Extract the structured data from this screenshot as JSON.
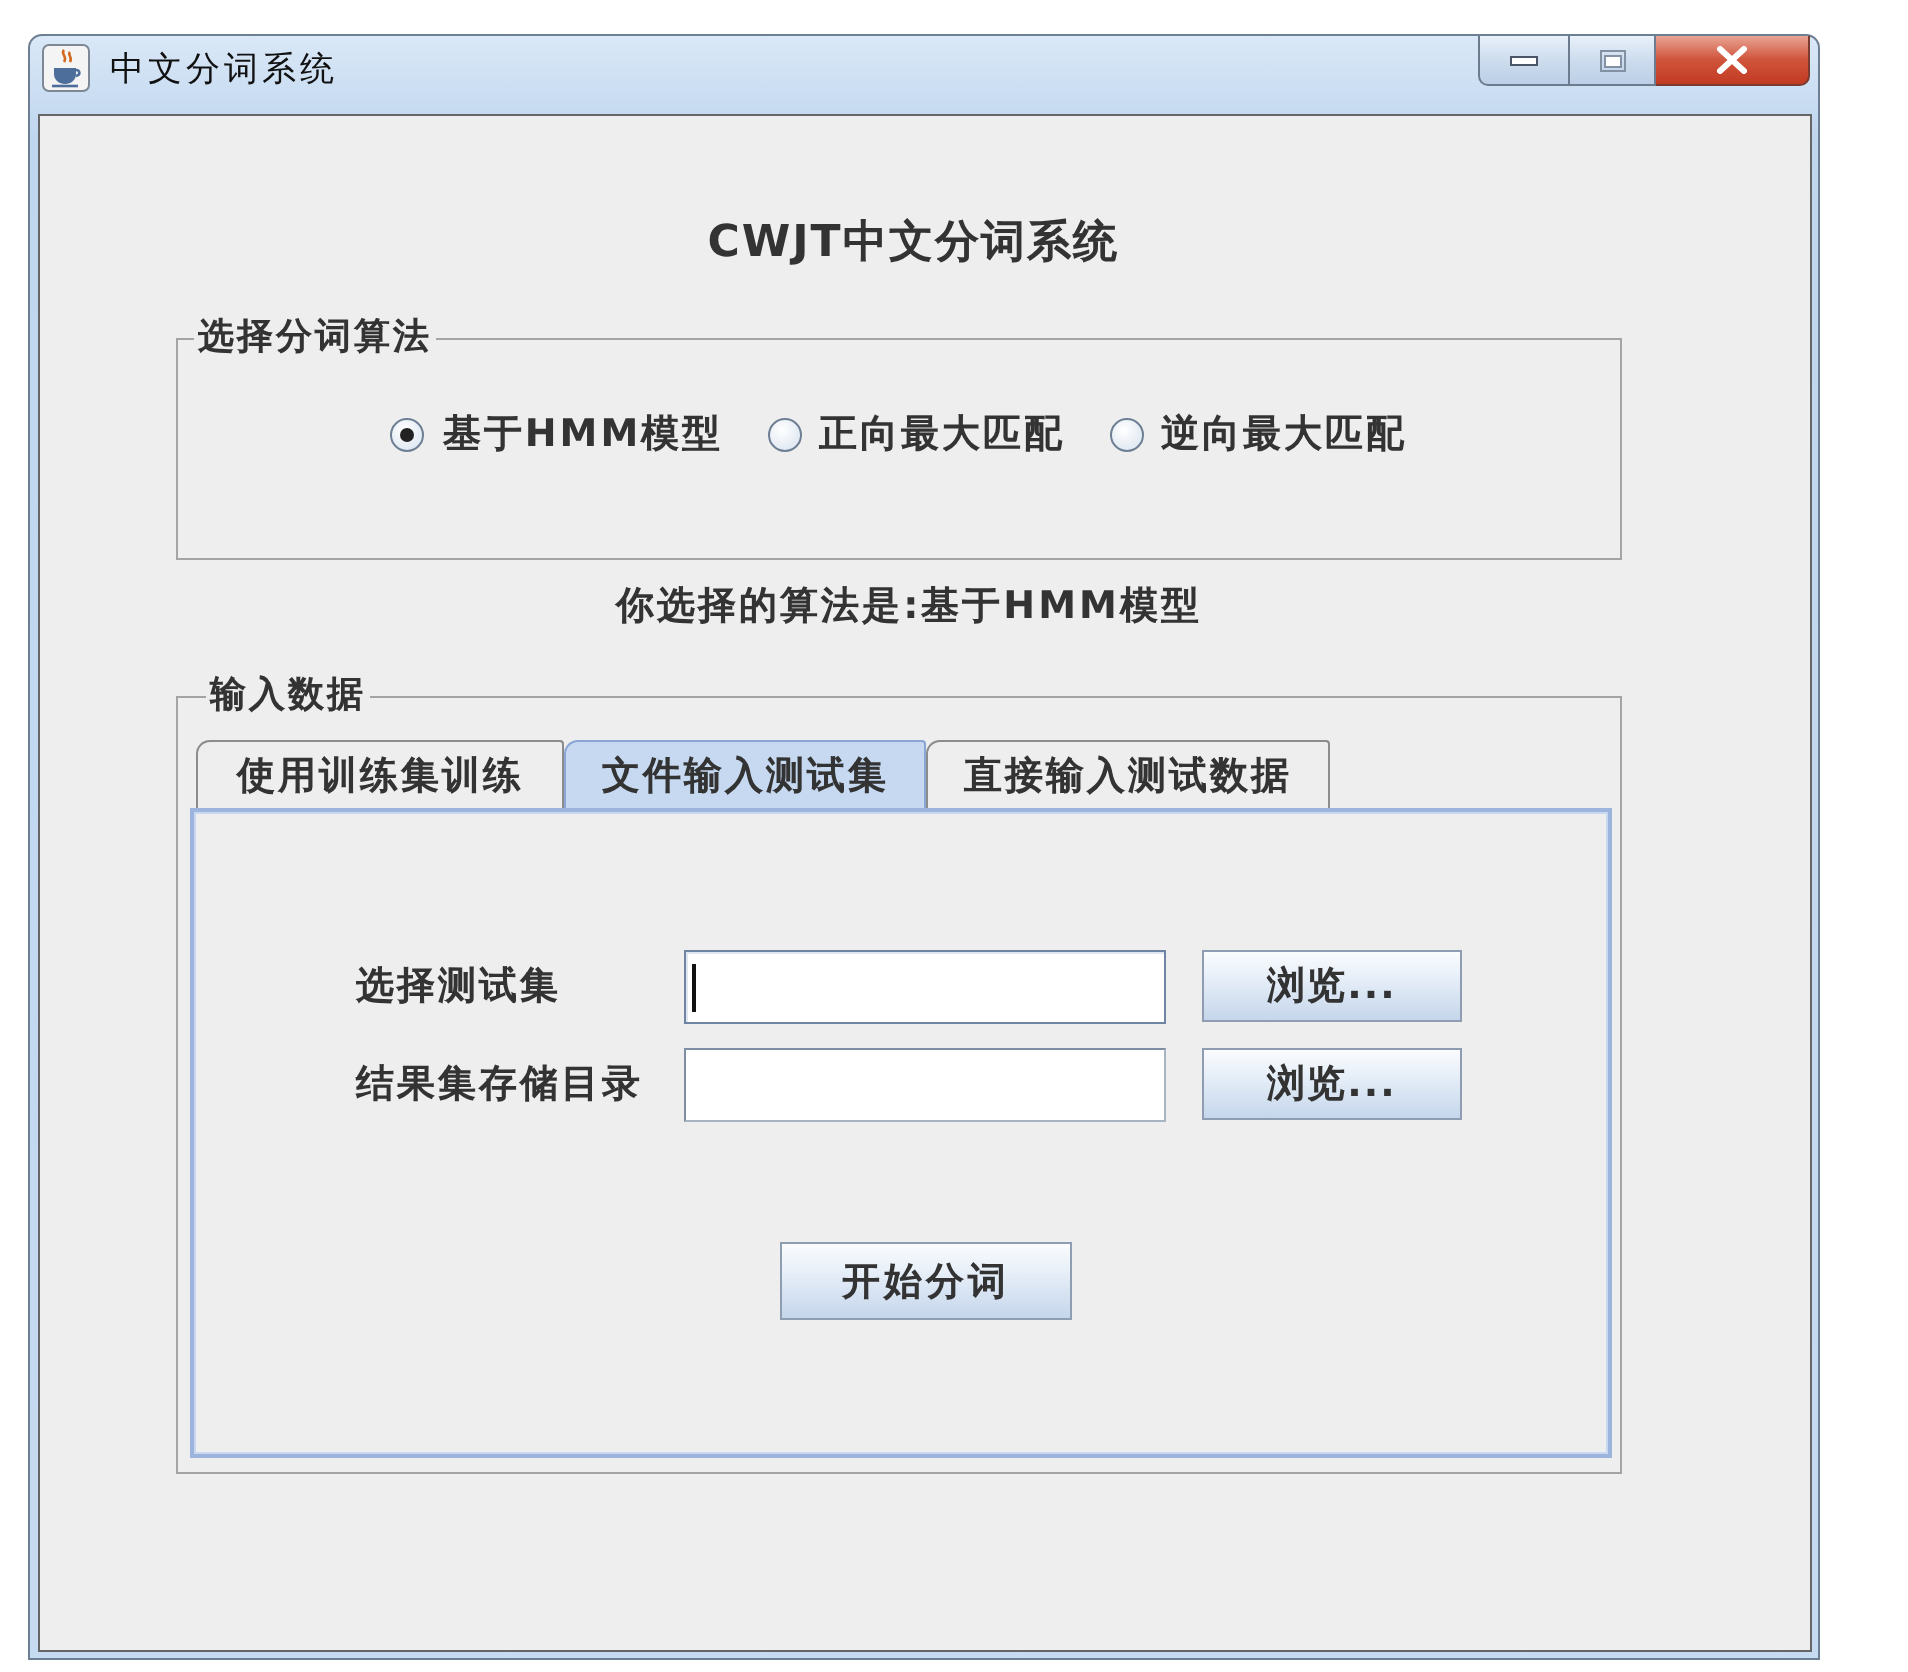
{
  "window": {
    "title": "中文分词系统"
  },
  "heading": "CWJT中文分词系统",
  "algorithm_group": {
    "legend": "选择分词算法",
    "options": [
      {
        "label": "基于HMM模型",
        "selected": true
      },
      {
        "label": "正向最大匹配",
        "selected": false
      },
      {
        "label": "逆向最大匹配",
        "selected": false
      }
    ]
  },
  "selection_status": "你选择的算法是:基于HMM模型",
  "input_group": {
    "legend": "输入数据",
    "tabs": [
      {
        "label": "使用训练集训练",
        "selected": false
      },
      {
        "label": "文件输入测试集",
        "selected": true
      },
      {
        "label": "直接输入测试数据",
        "selected": false
      }
    ],
    "fields": [
      {
        "label": "选择测试集",
        "focused": true,
        "button": "浏览..."
      },
      {
        "label": "结果集存储目录",
        "focused": false,
        "button": "浏览..."
      }
    ],
    "start_button": "开始分词"
  }
}
